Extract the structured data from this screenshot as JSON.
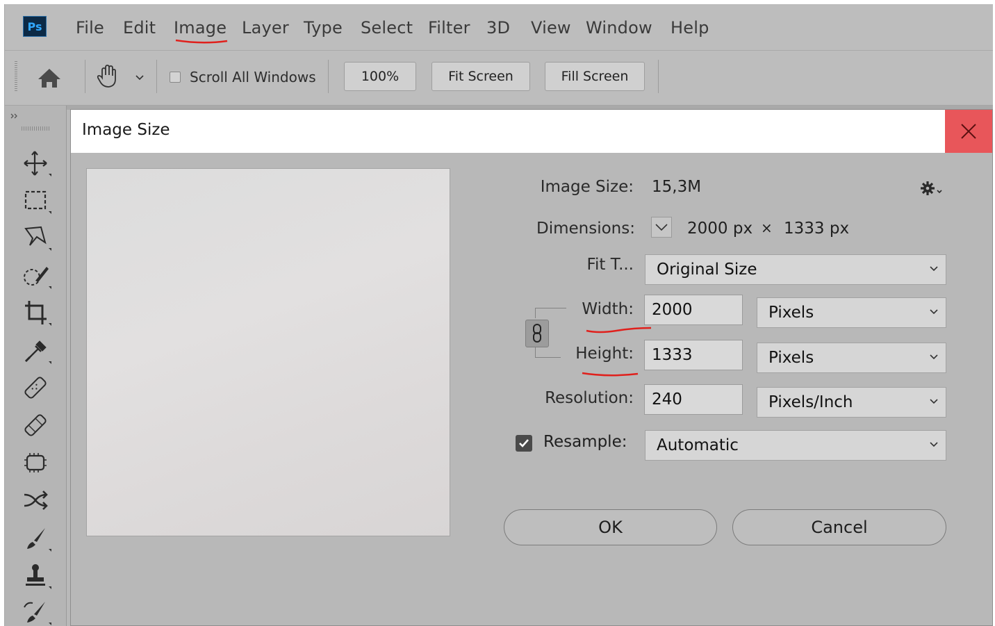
{
  "app": {
    "logo_text": "Ps",
    "menu": [
      "File",
      "Edit",
      "Image",
      "Layer",
      "Type",
      "Select",
      "Filter",
      "3D",
      "View",
      "Window",
      "Help"
    ]
  },
  "options_bar": {
    "scroll_all_label": "Scroll All Windows",
    "zoom_button": "100%",
    "fit_screen_button": "Fit Screen",
    "fill_screen_button": "Fill Screen"
  },
  "dialog": {
    "title": "Image Size",
    "image_size_label": "Image Size:",
    "image_size_value": "15,3M",
    "dimensions_label": "Dimensions:",
    "dimensions_width": "2000 px",
    "dimensions_times": "×",
    "dimensions_height": "1333 px",
    "fit_to_label": "Fit T...",
    "fit_to_value": "Original Size",
    "width_label": "Width:",
    "width_value": "2000",
    "width_unit": "Pixels",
    "height_label": "Height:",
    "height_value": "1333",
    "height_unit": "Pixels",
    "resolution_label": "Resolution:",
    "resolution_value": "240",
    "resolution_unit": "Pixels/Inch",
    "resample_label": "Resample:",
    "resample_checked": true,
    "resample_value": "Automatic",
    "ok_button": "OK",
    "cancel_button": "Cancel"
  },
  "colors": {
    "accent_close": "#e8565a",
    "annotation_red": "#e0201c"
  }
}
